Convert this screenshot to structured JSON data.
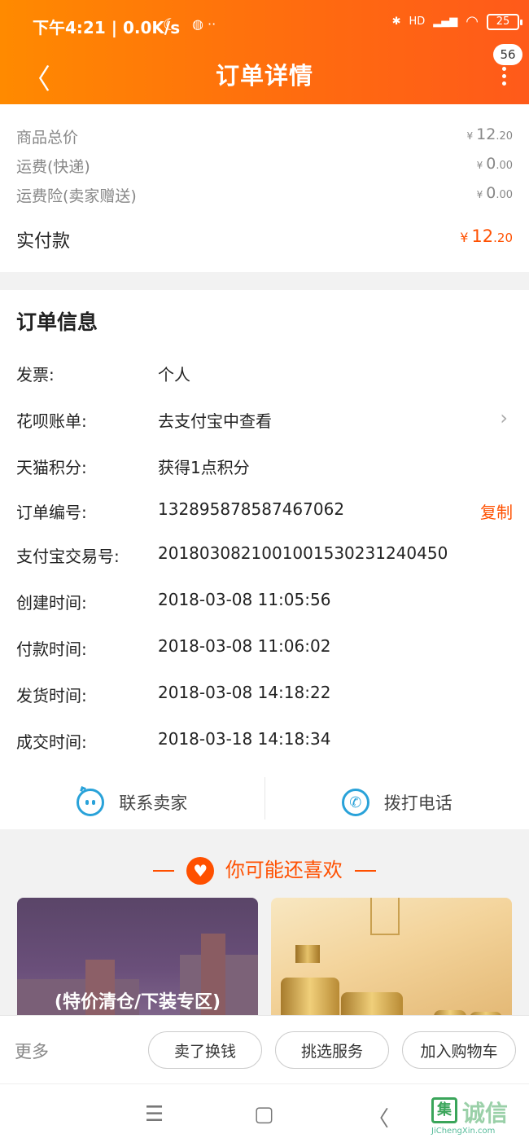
{
  "status_bar": {
    "time": "下午4:21 | 0.0K/s",
    "signal": "HD",
    "battery": "25"
  },
  "header": {
    "title": "订单详情",
    "badge_count": "56"
  },
  "price": {
    "rows": [
      {
        "label": "商品总价",
        "int": "12",
        "dec": ".20"
      },
      {
        "label": "运费(快递)",
        "int": "0",
        "dec": ".00"
      },
      {
        "label": "运费险(卖家赠送)",
        "int": "0",
        "dec": ".00"
      }
    ],
    "total": {
      "label": "实付款",
      "int": "12",
      "dec": ".20"
    },
    "currency": "¥"
  },
  "order_info": {
    "title": "订单信息",
    "rows": [
      {
        "label": "发票:",
        "value": "个人"
      },
      {
        "label": "花呗账单:",
        "value": "去支付宝中查看"
      },
      {
        "label": "天猫积分:",
        "value": "获得1点积分"
      },
      {
        "label": "订单编号:",
        "value": "132895878587467062",
        "action": "复制"
      },
      {
        "label": "支付宝交易号:",
        "value": "2018030821001001530231240450"
      },
      {
        "label": "创建时间:",
        "value": "2018-03-08 11:05:56"
      },
      {
        "label": "付款时间:",
        "value": "2018-03-08 11:06:02"
      },
      {
        "label": "发货时间:",
        "value": "2018-03-08 14:18:22"
      },
      {
        "label": "成交时间:",
        "value": "2018-03-18 14:18:34"
      }
    ],
    "contact_seller": "联系卖家",
    "call_phone": "拨打电话"
  },
  "recommend": {
    "title": "你可能还喜欢",
    "cards": [
      {
        "caption": "(特价清仓/下装专区)"
      },
      {
        "caption": ""
      }
    ]
  },
  "bottom_bar": {
    "more": "更多",
    "buttons": [
      "卖了换钱",
      "挑选服务",
      "加入购物车"
    ]
  },
  "watermark": {
    "text": "诚信",
    "mark": "集",
    "url": "JiChengXin.com"
  },
  "colors": {
    "accent": "#ff5000",
    "header_start": "#ff8a00",
    "icon_blue": "#29a2d9"
  }
}
